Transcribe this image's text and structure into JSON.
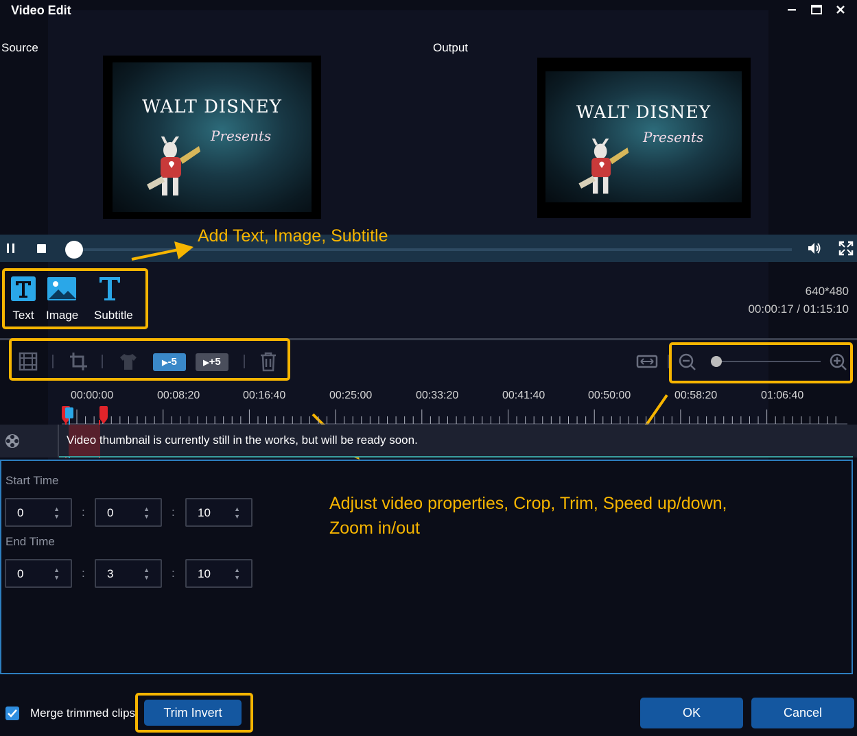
{
  "window": {
    "title": "Video Edit",
    "minimize_icon": "minimize-icon",
    "maximize_icon": "maximize-icon",
    "close_icon": "close-icon"
  },
  "preview": {
    "source_label": "Source",
    "output_label": "Output",
    "video_title": "WALT DISNEY",
    "video_subtitle": "Presents"
  },
  "playbar": {
    "pause_icon": "pause-icon",
    "stop_icon": "stop-icon",
    "volume_icon": "volume-icon",
    "fullscreen_icon": "fullscreen-icon",
    "progress_fraction": 0.004
  },
  "annotations": {
    "add_text": "Add Text, Image, Subtitle",
    "adjust": "Adjust video properties, Crop, Trim, Speed up/down,",
    "adjust_line2": "Zoom in/out"
  },
  "tools": [
    {
      "label": "Text",
      "icon": "text-icon"
    },
    {
      "label": "Image",
      "icon": "image-icon"
    },
    {
      "label": "Subtitle",
      "icon": "subtitle-icon"
    }
  ],
  "info": {
    "resolution": "640*480",
    "time": "00:00:17 / 01:15:10"
  },
  "toolbar": {
    "speed_down": "-5",
    "speed_up": "+5",
    "icons": [
      "film-icon",
      "crop-icon",
      "shirt-icon",
      "trash-icon",
      "fit-width-icon",
      "zoom-out-icon",
      "zoom-in-icon"
    ],
    "zoom_fraction": 0.05
  },
  "timeline": {
    "ticks": [
      "00:00:00",
      "00:08:20",
      "00:16:40",
      "00:25:00",
      "00:33:20",
      "00:41:40",
      "00:50:00",
      "00:58:20",
      "01:06:40"
    ],
    "message": "Video thumbnail is currently still in the works, but will be ready soon."
  },
  "trim": {
    "start_label": "Start Time",
    "end_label": "End Time",
    "start": [
      "0",
      "0",
      "10"
    ],
    "end": [
      "0",
      "3",
      "10"
    ]
  },
  "footer": {
    "merge_label": "Merge trimmed clips",
    "trim_invert": "Trim Invert",
    "ok": "OK",
    "cancel": "Cancel"
  },
  "colors": {
    "accent_yellow": "#f7b500",
    "button_blue": "#1457a0",
    "playbar": "#1b3347",
    "icon_blue": "#2aa7e8"
  }
}
